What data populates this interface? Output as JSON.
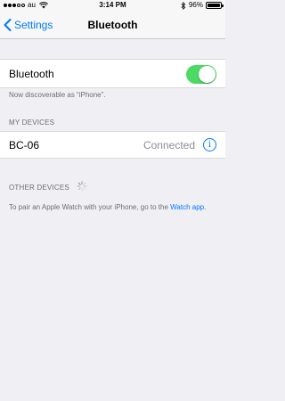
{
  "status_bar": {
    "carrier": "au",
    "time": "3:14 PM",
    "battery": "96%",
    "battery_level": 0.96,
    "icons": [
      "signal-dots",
      "wifi-icon",
      "bluetooth-icon",
      "battery-icon"
    ]
  },
  "nav": {
    "back_label": "Settings",
    "title": "Bluetooth"
  },
  "bluetooth_row": {
    "label": "Bluetooth",
    "enabled": true
  },
  "discoverable_text": "Now discoverable as “iPhone”.",
  "my_devices": {
    "header": "MY DEVICES",
    "items": [
      {
        "name": "BC-06",
        "status": "Connected",
        "info": "i"
      }
    ]
  },
  "other_devices": {
    "header": "OTHER DEVICES"
  },
  "pair_note": {
    "text": "To pair an Apple Watch with your iPhone, go to the",
    "link": "Watch app",
    "end": "."
  },
  "colors": {
    "accent": "#007aff",
    "toggle_on": "#4cd964",
    "background": "#efeff4",
    "secondary_text": "#6d6d72"
  }
}
